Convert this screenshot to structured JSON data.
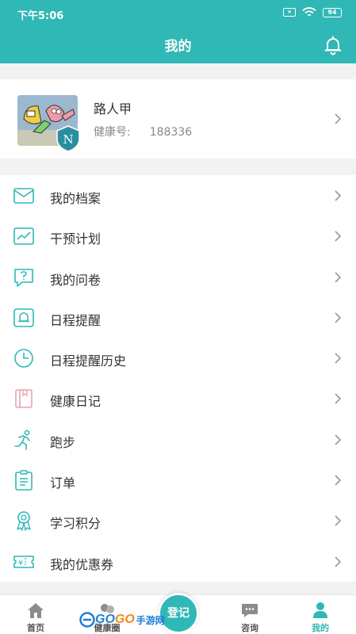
{
  "status_bar": {
    "time": "下午5:06",
    "battery": "94"
  },
  "header": {
    "title": "我的"
  },
  "profile": {
    "name": "路人甲",
    "health_id_label": "健康号:",
    "health_id_value": "188336"
  },
  "menu": [
    {
      "label": "我的档案",
      "icon": "envelope-icon"
    },
    {
      "label": "干预计划",
      "icon": "trend-chart-icon"
    },
    {
      "label": "我的问卷",
      "icon": "question-icon"
    },
    {
      "label": "日程提醒",
      "icon": "bell-icon"
    },
    {
      "label": "日程提醒历史",
      "icon": "clock-icon"
    },
    {
      "label": "健康日记",
      "icon": "book-icon"
    },
    {
      "label": "跑步",
      "icon": "runner-icon"
    },
    {
      "label": "订单",
      "icon": "clipboard-icon"
    },
    {
      "label": "学习积分",
      "icon": "medal-icon"
    },
    {
      "label": "我的优惠券",
      "icon": "coupon-icon"
    }
  ],
  "tabbar": {
    "home": "首页",
    "circle": "健康圈",
    "register": "登记",
    "consult": "咨询",
    "mine": "我的"
  },
  "watermark": {
    "left": "GO",
    "right": "GO",
    "cn": "手游网"
  },
  "colors": {
    "accent": "#2fb8b6",
    "diary_icon": "#e9a2ad"
  }
}
